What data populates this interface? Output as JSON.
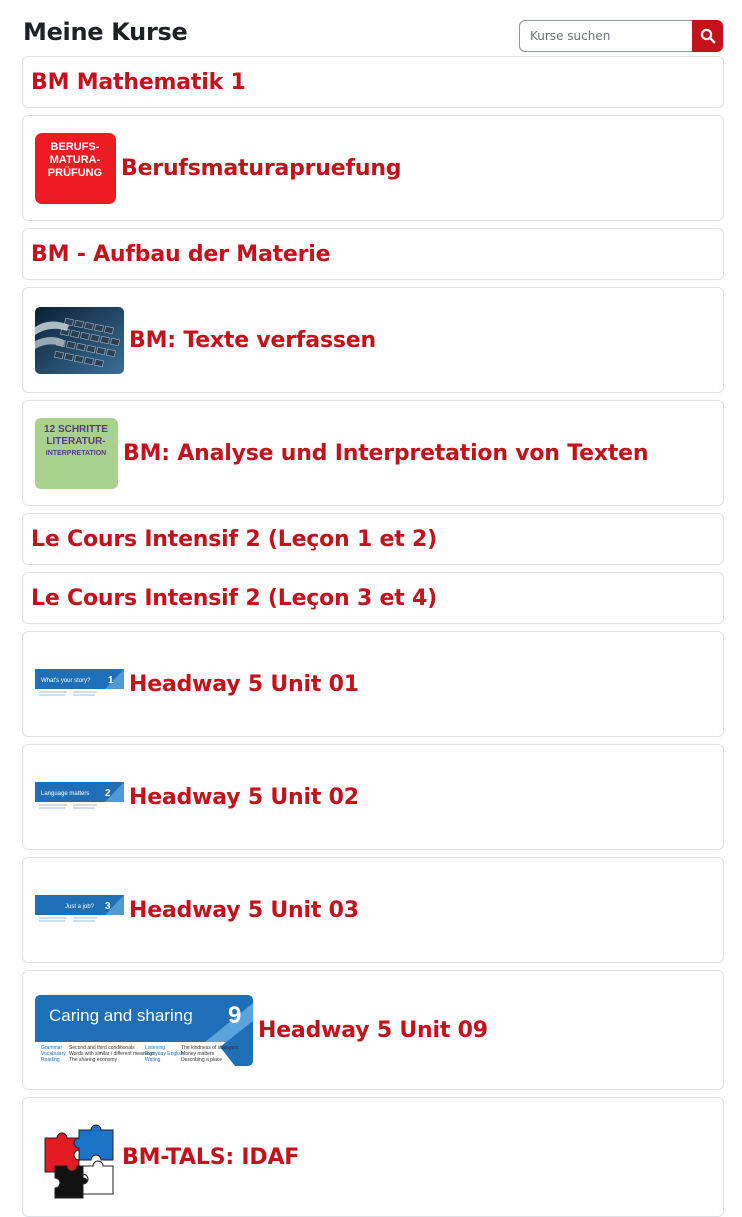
{
  "header": {
    "title": "Meine Kurse",
    "search_placeholder": "Kurse suchen"
  },
  "icons": {
    "search": "search-icon"
  },
  "colors": {
    "accent": "#c4121c",
    "title_text": "#1d2125",
    "card_border": "#dee2e6"
  },
  "thumbnails": {
    "berufsmatura": {
      "line1": "BERUFS-",
      "line2": "MATURA-",
      "line3": "PRÜFUNG"
    },
    "literatur": {
      "line1": "12 SCHRITTE",
      "line2": "LITERATUR-",
      "line3": "INTERPRETATION"
    },
    "headway01": {
      "title": "What's your story?",
      "number": "1"
    },
    "headway02": {
      "title": "Language matters",
      "number": "2"
    },
    "headway03": {
      "title": "Just a job?",
      "number": "3"
    },
    "headway09": {
      "title": "Caring and sharing",
      "number": "9",
      "col1": [
        "Grammar",
        "Vocabulary",
        "Reading"
      ],
      "col1_text": [
        "Second and third conditionals",
        "Words with similar / different meanings",
        "The sharing economy"
      ],
      "col2": [
        "Listening",
        "Everyday English",
        "Writing"
      ],
      "col2_text": [
        "The kindness of strangers",
        "Money matters",
        "Describing a place"
      ]
    }
  },
  "courses": [
    {
      "title": "BM Mathematik 1"
    },
    {
      "title": "Berufsmaturapruefung"
    },
    {
      "title": "BM - Aufbau der Materie"
    },
    {
      "title": "BM: Texte verfassen"
    },
    {
      "title": "BM: Analyse und Interpretation von Texten"
    },
    {
      "title": "Le Cours Intensif 2 (Leçon 1 et 2)"
    },
    {
      "title": "Le Cours Intensif 2 (Leçon 3 et 4)"
    },
    {
      "title": "Headway 5 Unit 01"
    },
    {
      "title": "Headway 5 Unit 02"
    },
    {
      "title": "Headway 5 Unit 03"
    },
    {
      "title": "Headway 5 Unit 09"
    },
    {
      "title": "BM-TALS: IDAF"
    }
  ]
}
